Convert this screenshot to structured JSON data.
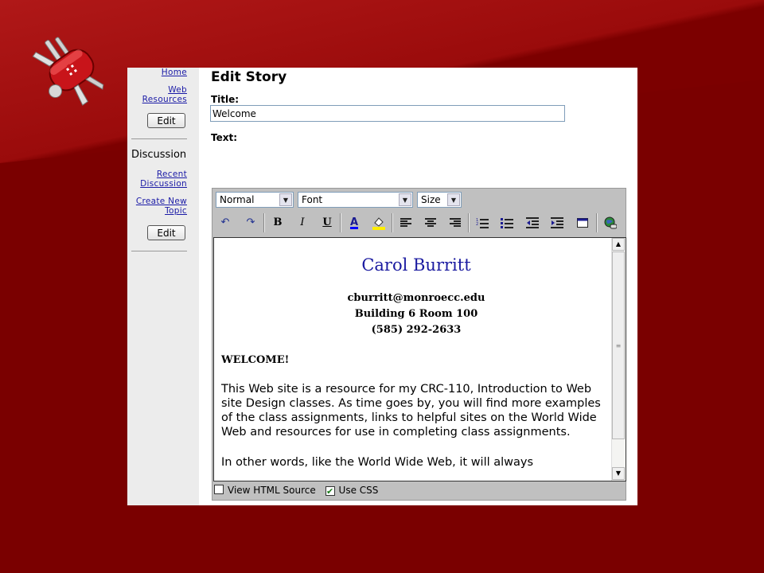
{
  "sidebar": {
    "home": "Home",
    "web_resources": "Web Resources",
    "edit1": "Edit",
    "discussion_heading": "Discussion",
    "recent_discussion": "Recent Discussion",
    "create_topic": "Create New Topic",
    "edit2": "Edit"
  },
  "form": {
    "page_title": "Edit Story",
    "title_label": "Title:",
    "title_value": "Welcome",
    "text_label": "Text:"
  },
  "toolbar": {
    "format_select": "Normal",
    "font_select": "Font",
    "size_select": "Size",
    "icons": [
      "undo-icon",
      "redo-icon",
      "bold-icon",
      "italic-icon",
      "underline-icon",
      "font-color-icon",
      "highlight-icon",
      "align-left-icon",
      "align-center-icon",
      "align-right-icon",
      "ordered-list-icon",
      "unordered-list-icon",
      "outdent-icon",
      "indent-icon",
      "table-icon",
      "insert-link-icon"
    ]
  },
  "document": {
    "name": "Carol Burritt",
    "email": "cburritt@monroecc.edu",
    "building": "Building 6 Room 100",
    "phone": "(585) 292-2633",
    "welcome": "WELCOME!",
    "para1": "This Web site is a resource for my CRC-110, Introduction to Web site Design classes. As time goes by, you will find more examples of the class assignments, links to helpful sites on the World Wide Web and resources for use in completing class assignments.",
    "para2": "In other words, like the World Wide Web, it will always"
  },
  "footer": {
    "view_html": "View HTML Source",
    "use_css": "Use CSS",
    "view_html_checked": false,
    "use_css_checked": true
  },
  "colors": {
    "background": "#7a0000",
    "name_blue": "#1a1aa0",
    "link_blue": "#1a1aa6"
  }
}
